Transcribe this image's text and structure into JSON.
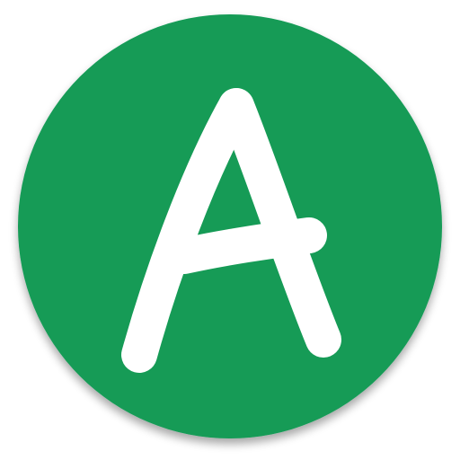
{
  "app_icon": {
    "icon": "letter-a-icon",
    "letter": "A",
    "background_color": "#129b56",
    "letter_color": "#ffffff"
  }
}
